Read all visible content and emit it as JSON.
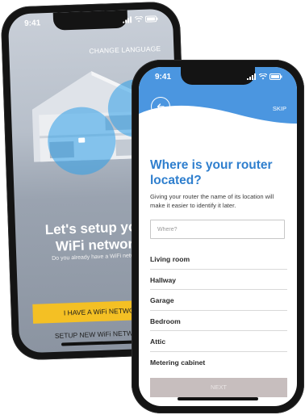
{
  "back_screen": {
    "status_time": "9:41",
    "change_language": "CHANGE LANGUAGE",
    "title_line1": "Let's setup your",
    "title_line2": "WiFi network",
    "subtitle": "Do you already have a WiFi network?",
    "primary_button": "I HAVE A WiFi NETWORK",
    "secondary_link": "SETUP NEW WiFi NETWORK",
    "accent_color": "#f4c024"
  },
  "front_screen": {
    "status_time": "9:41",
    "skip": "SKIP",
    "title": "Where is your router located?",
    "description": "Giving your router the name of its location will make it easier to identify it later.",
    "search_placeholder": "Where?",
    "locations": [
      "Living room",
      "Hallway",
      "Garage",
      "Bedroom",
      "Attic",
      "Metering cabinet"
    ],
    "next_button": "NEXT",
    "header_color": "#4b96e0",
    "title_color": "#2f7fce"
  }
}
